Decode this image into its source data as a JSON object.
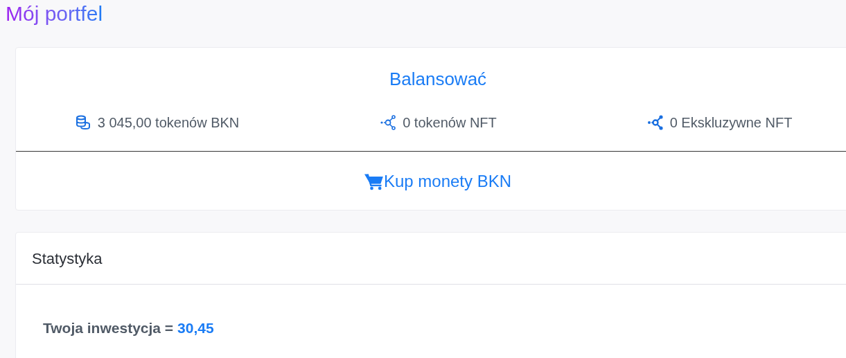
{
  "page_title": "Mój portfel",
  "balance": {
    "title": "Balansować",
    "stats": [
      {
        "kind": "coins",
        "text": "3 045,00 tokenów BKN"
      },
      {
        "kind": "nodes",
        "text": "0 tokenów NFT"
      },
      {
        "kind": "nodes-filled",
        "text": "0 Ekskluzywne NFT"
      }
    ],
    "buy_link": "Kup monety BKN"
  },
  "statistics": {
    "title": "Statystyka",
    "investment_label": "Twoja inwestycja =",
    "investment_value": "30,45"
  }
}
